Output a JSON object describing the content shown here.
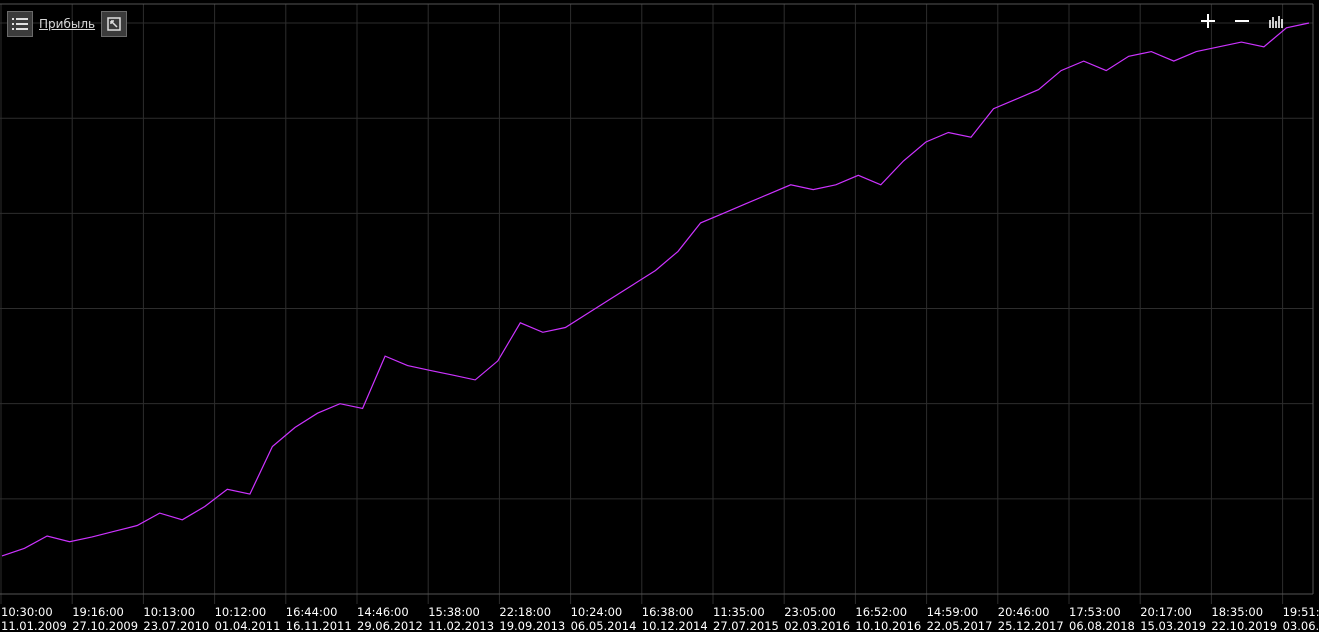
{
  "toolbar": {
    "series_label": "Прибыль"
  },
  "colors": {
    "background": "#000000",
    "grid": "#2d2d2d",
    "line": "#cc33ff",
    "axis_text": "#ffffff",
    "button_bg": "#3b3b3b"
  },
  "icons": {
    "menu": "list-icon",
    "expand": "expand-icon",
    "zoom_in": "plus-icon",
    "zoom_out": "minus-icon",
    "fit": "bar-fit-icon"
  },
  "chart_data": {
    "type": "line",
    "title": "",
    "xlabel": "",
    "ylabel": "",
    "grid": true,
    "legend": "none",
    "series": [
      {
        "name": "Прибыль",
        "values": [
          0.4,
          0.48,
          0.61,
          0.55,
          0.6,
          0.66,
          0.72,
          0.85,
          0.78,
          0.92,
          1.1,
          1.05,
          1.55,
          1.75,
          1.9,
          2.0,
          1.95,
          2.5,
          2.4,
          2.35,
          2.3,
          2.25,
          2.45,
          2.85,
          2.75,
          2.8,
          2.95,
          3.1,
          3.25,
          3.4,
          3.6,
          3.9,
          4.0,
          4.1,
          4.2,
          4.3,
          4.25,
          4.3,
          4.4,
          4.3,
          4.55,
          4.75,
          4.85,
          4.8,
          5.1,
          5.2,
          5.3,
          5.5,
          5.6,
          5.5,
          5.65,
          5.7,
          5.6,
          5.7,
          5.75,
          5.8,
          5.75,
          5.95,
          6.0
        ]
      }
    ],
    "x_tick_labels": [
      {
        "time": "10:30:00",
        "date": "11.01.2009"
      },
      {
        "time": "19:16:00",
        "date": "27.10.2009"
      },
      {
        "time": "10:13:00",
        "date": "23.07.2010"
      },
      {
        "time": "10:12:00",
        "date": "01.04.2011"
      },
      {
        "time": "16:44:00",
        "date": "16.11.2011"
      },
      {
        "time": "14:46:00",
        "date": "29.06.2012"
      },
      {
        "time": "15:38:00",
        "date": "11.02.2013"
      },
      {
        "time": "22:18:00",
        "date": "19.09.2013"
      },
      {
        "time": "10:24:00",
        "date": "06.05.2014"
      },
      {
        "time": "16:38:00",
        "date": "10.12.2014"
      },
      {
        "time": "11:35:00",
        "date": "27.07.2015"
      },
      {
        "time": "23:05:00",
        "date": "02.03.2016"
      },
      {
        "time": "16:52:00",
        "date": "10.10.2016"
      },
      {
        "time": "14:59:00",
        "date": "22.05.2017"
      },
      {
        "time": "20:46:00",
        "date": "25.12.2017"
      },
      {
        "time": "17:53:00",
        "date": "06.08.2018"
      },
      {
        "time": "20:17:00",
        "date": "15.03.2019"
      },
      {
        "time": "18:35:00",
        "date": "22.10.2019"
      },
      {
        "time": "19:51:",
        "date": "03.06."
      }
    ],
    "ylim": [
      0,
      6.2
    ]
  }
}
